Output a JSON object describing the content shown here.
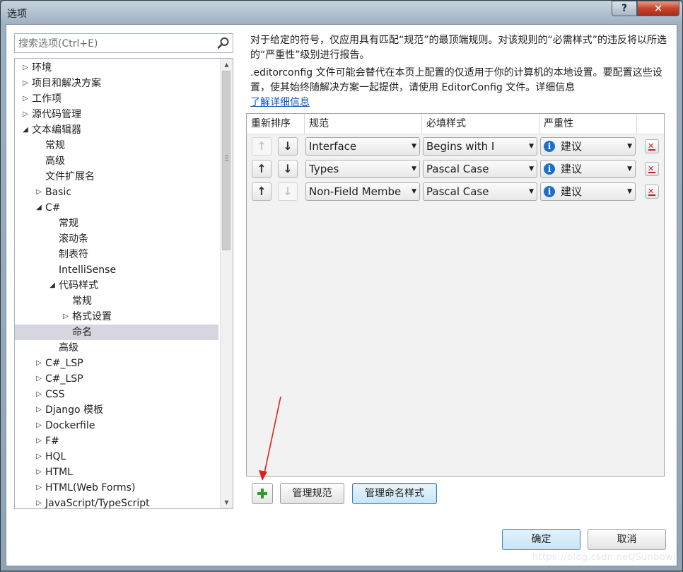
{
  "window": {
    "title": "选项",
    "help_label": "?",
    "close_label": "✕"
  },
  "search": {
    "placeholder": "搜索选项(Ctrl+E)"
  },
  "tree": {
    "items": [
      {
        "label": "环境",
        "indent": 0,
        "expander": "collapsed"
      },
      {
        "label": "项目和解决方案",
        "indent": 0,
        "expander": "collapsed"
      },
      {
        "label": "工作项",
        "indent": 0,
        "expander": "collapsed"
      },
      {
        "label": "源代码管理",
        "indent": 0,
        "expander": "collapsed"
      },
      {
        "label": "文本编辑器",
        "indent": 0,
        "expander": "expanded"
      },
      {
        "label": "常规",
        "indent": 1,
        "expander": "none"
      },
      {
        "label": "高级",
        "indent": 1,
        "expander": "none"
      },
      {
        "label": "文件扩展名",
        "indent": 1,
        "expander": "none"
      },
      {
        "label": "Basic",
        "indent": 1,
        "expander": "collapsed"
      },
      {
        "label": "C#",
        "indent": 1,
        "expander": "expanded"
      },
      {
        "label": "常规",
        "indent": 2,
        "expander": "none"
      },
      {
        "label": "滚动条",
        "indent": 2,
        "expander": "none"
      },
      {
        "label": "制表符",
        "indent": 2,
        "expander": "none"
      },
      {
        "label": "IntelliSense",
        "indent": 2,
        "expander": "none"
      },
      {
        "label": "代码样式",
        "indent": 2,
        "expander": "expanded"
      },
      {
        "label": "常规",
        "indent": 3,
        "expander": "none"
      },
      {
        "label": "格式设置",
        "indent": 3,
        "expander": "collapsed"
      },
      {
        "label": "命名",
        "indent": 3,
        "expander": "none",
        "selected": true
      },
      {
        "label": "高级",
        "indent": 2,
        "expander": "none"
      },
      {
        "label": "C#_LSP",
        "indent": 1,
        "expander": "collapsed"
      },
      {
        "label": "C#_LSP",
        "indent": 1,
        "expander": "collapsed"
      },
      {
        "label": "CSS",
        "indent": 1,
        "expander": "collapsed"
      },
      {
        "label": "Django 模板",
        "indent": 1,
        "expander": "collapsed"
      },
      {
        "label": "Dockerfile",
        "indent": 1,
        "expander": "collapsed"
      },
      {
        "label": "F#",
        "indent": 1,
        "expander": "collapsed"
      },
      {
        "label": "HQL",
        "indent": 1,
        "expander": "collapsed"
      },
      {
        "label": "HTML",
        "indent": 1,
        "expander": "collapsed"
      },
      {
        "label": "HTML(Web Forms)",
        "indent": 1,
        "expander": "collapsed"
      },
      {
        "label": "JavaScript/TypeScript",
        "indent": 1,
        "expander": "collapsed"
      }
    ]
  },
  "description": {
    "line1": "对于给定的符号，仅应用具有匹配“规范”的最顶端规则。对该规则的“必需样式”的违反将以所选的“严重性”级别进行报告。",
    "line2": ".editorconfig 文件可能会替代在本页上配置的仅适用于你的计算机的本地设置。要配置这些设置，使其始终随解决方案一起提供，请使用 EditorConfig 文件。详细信息",
    "link": "了解详细信息"
  },
  "grid": {
    "headers": [
      "重新排序",
      "规范",
      "必填样式",
      "严重性"
    ],
    "rows": [
      {
        "up_enabled": false,
        "down_enabled": true,
        "spec": "Interface",
        "style": "Begins with I",
        "severity": "建议"
      },
      {
        "up_enabled": true,
        "down_enabled": true,
        "spec": "Types",
        "style": "Pascal Case",
        "severity": "建议"
      },
      {
        "up_enabled": true,
        "down_enabled": false,
        "spec": "Non-Field Membe",
        "style": "Pascal Case",
        "severity": "建议"
      }
    ]
  },
  "buttons": {
    "manage_specs": "管理规范",
    "manage_styles": "管理命名样式",
    "ok": "确定",
    "cancel": "取消"
  },
  "icons": {
    "search": "search-icon",
    "up": "arrow-up-icon",
    "down": "arrow-down-icon",
    "info": "info-icon",
    "delete": "delete-icon",
    "add": "plus-icon"
  },
  "colors": {
    "accent": "#1c6fc7",
    "add_green": "#2f9a2f",
    "delete_red": "#c0202a",
    "annotation_red": "#e02020",
    "selection": "#d6d6e1"
  },
  "watermark": "https://blog.csdn.net/Sunbowi"
}
